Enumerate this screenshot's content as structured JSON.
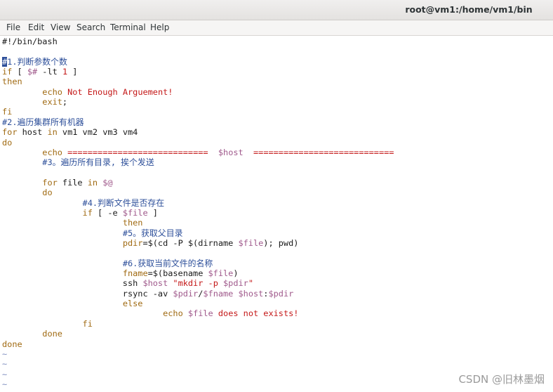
{
  "window": {
    "title": "root@vm1:/home/vm1/bin"
  },
  "menu": [
    {
      "name": "menu-file",
      "label": "File"
    },
    {
      "name": "menu-edit",
      "label": "Edit"
    },
    {
      "name": "menu-view",
      "label": "View"
    },
    {
      "name": "menu-search",
      "label": "Search"
    },
    {
      "name": "menu-terminal",
      "label": "Terminal"
    },
    {
      "name": "menu-help",
      "label": "Help"
    }
  ],
  "colors": {
    "keyword": "#a06a12",
    "comment": "#2d4f9a",
    "string": "#c41818",
    "variable": "#a05a8c",
    "tilde": "#7f8fc0",
    "cursor": "#2d4f9a"
  },
  "terminal": {
    "lines": [
      [
        [
          "plain",
          "#!/bin/bash"
        ]
      ],
      [],
      [
        [
          "cursor",
          "#"
        ],
        [
          "cm",
          "1.判断参数个数"
        ]
      ],
      [
        [
          "kw",
          "if"
        ],
        [
          "plain",
          " [ "
        ],
        [
          "var",
          "$#"
        ],
        [
          "plain",
          " -lt "
        ],
        [
          "num",
          "1"
        ],
        [
          "plain",
          " ]"
        ]
      ],
      [
        [
          "kw",
          "then"
        ]
      ],
      [
        [
          "plain",
          "        "
        ],
        [
          "kw",
          "echo"
        ],
        [
          "plain",
          " "
        ],
        [
          "str",
          "Not Enough Arguement!"
        ]
      ],
      [
        [
          "plain",
          "        "
        ],
        [
          "kw",
          "exit"
        ],
        [
          "plain",
          ";"
        ]
      ],
      [
        [
          "kw",
          "fi"
        ]
      ],
      [
        [
          "cm",
          "#2.遍历集群所有机器"
        ]
      ],
      [
        [
          "kw",
          "for"
        ],
        [
          "plain",
          " host "
        ],
        [
          "kw",
          "in"
        ],
        [
          "plain",
          " vm1 vm2 vm3 vm4"
        ]
      ],
      [
        [
          "kw",
          "do"
        ]
      ],
      [
        [
          "plain",
          "        "
        ],
        [
          "kw",
          "echo"
        ],
        [
          "plain",
          " "
        ],
        [
          "str",
          "============================"
        ],
        [
          "plain",
          "  "
        ],
        [
          "var",
          "$host"
        ],
        [
          "plain",
          "  "
        ],
        [
          "str",
          "============================"
        ]
      ],
      [
        [
          "plain",
          "        "
        ],
        [
          "cm",
          "#3。遍历所有目录, 挨个发送"
        ]
      ],
      [],
      [
        [
          "plain",
          "        "
        ],
        [
          "kw",
          "for"
        ],
        [
          "plain",
          " file "
        ],
        [
          "kw",
          "in"
        ],
        [
          "plain",
          " "
        ],
        [
          "var",
          "$@"
        ]
      ],
      [
        [
          "plain",
          "        "
        ],
        [
          "kw",
          "do"
        ]
      ],
      [
        [
          "plain",
          "                "
        ],
        [
          "cm",
          "#4.判断文件是否存在"
        ]
      ],
      [
        [
          "plain",
          "                "
        ],
        [
          "kw",
          "if"
        ],
        [
          "plain",
          " [ -e "
        ],
        [
          "var",
          "$file"
        ],
        [
          "plain",
          " ]"
        ]
      ],
      [
        [
          "plain",
          "                        "
        ],
        [
          "kw",
          "then"
        ]
      ],
      [
        [
          "plain",
          "                        "
        ],
        [
          "cm",
          "#5。获取父目录"
        ]
      ],
      [
        [
          "plain",
          "                        "
        ],
        [
          "kw",
          "pdir"
        ],
        [
          "plain",
          "=$(cd -P $(dirname "
        ],
        [
          "var",
          "$file"
        ],
        [
          "plain",
          "); pwd)"
        ]
      ],
      [],
      [
        [
          "plain",
          "                        "
        ],
        [
          "cm",
          "#6.获取当前文件的名称"
        ]
      ],
      [
        [
          "plain",
          "                        "
        ],
        [
          "kw",
          "fname"
        ],
        [
          "plain",
          "=$(basename "
        ],
        [
          "var",
          "$file"
        ],
        [
          "plain",
          ")"
        ]
      ],
      [
        [
          "plain",
          "                        ssh "
        ],
        [
          "var",
          "$host"
        ],
        [
          "plain",
          " "
        ],
        [
          "str",
          "\"mkdir -p "
        ],
        [
          "var",
          "$pdir"
        ],
        [
          "str",
          "\""
        ]
      ],
      [
        [
          "plain",
          "                        rsync -av "
        ],
        [
          "var",
          "$pdir"
        ],
        [
          "plain",
          "/"
        ],
        [
          "var",
          "$fname"
        ],
        [
          "plain",
          " "
        ],
        [
          "var",
          "$host"
        ],
        [
          "plain",
          ":"
        ],
        [
          "var",
          "$pdir"
        ]
      ],
      [
        [
          "plain",
          "                        "
        ],
        [
          "kw",
          "else"
        ]
      ],
      [
        [
          "plain",
          "                                "
        ],
        [
          "kw",
          "echo"
        ],
        [
          "plain",
          " "
        ],
        [
          "var",
          "$file"
        ],
        [
          "plain",
          " "
        ],
        [
          "str",
          "does not exists!"
        ]
      ],
      [
        [
          "plain",
          "                "
        ],
        [
          "kw",
          "fi"
        ]
      ],
      [
        [
          "plain",
          "        "
        ],
        [
          "kw",
          "done"
        ]
      ],
      [
        [
          "kw",
          "done"
        ]
      ],
      [
        [
          "tilde",
          "~"
        ]
      ],
      [
        [
          "tilde",
          "~"
        ]
      ],
      [
        [
          "tilde",
          "~"
        ]
      ],
      [
        [
          "tilde",
          "~"
        ]
      ]
    ]
  },
  "watermark": "CSDN @旧林墨烟"
}
